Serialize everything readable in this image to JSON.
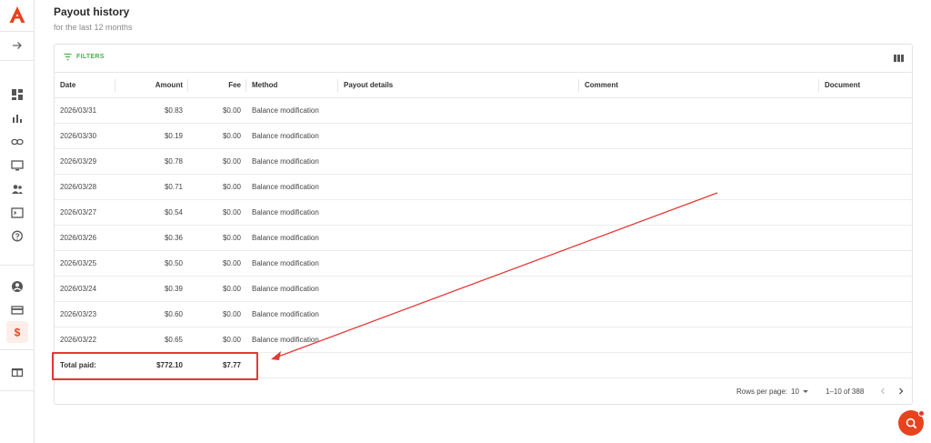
{
  "colors": {
    "brand": "#e8431f",
    "filters_green": "#4caf50",
    "annotation_red": "#e53935"
  },
  "sidebar": {
    "logo": "brand-logo-icon",
    "items": [
      {
        "icon": "arrow-right-icon",
        "name": "expand-sidebar"
      },
      {
        "icon": "dashboard-icon",
        "name": "dashboard"
      },
      {
        "icon": "bar-chart-icon",
        "name": "statistics"
      },
      {
        "icon": "link-icon",
        "name": "links"
      },
      {
        "icon": "monitor-icon",
        "name": "websites"
      },
      {
        "icon": "users-icon",
        "name": "referrals"
      },
      {
        "icon": "terminal-icon",
        "name": "api"
      },
      {
        "icon": "help-icon",
        "name": "help"
      },
      {
        "icon": "account-icon",
        "name": "account"
      },
      {
        "icon": "card-icon",
        "name": "payment-methods"
      },
      {
        "icon": "dollar-icon",
        "name": "payouts",
        "active": true
      },
      {
        "icon": "gift-icon",
        "name": "rewards"
      }
    ]
  },
  "header": {
    "title": "Payout history",
    "subtitle": "for the last 12 months"
  },
  "toolbar": {
    "filters_label": "FILTERS",
    "columns_icon": "columns-icon"
  },
  "table": {
    "columns": [
      "Date",
      "Amount",
      "Fee",
      "Method",
      "Payout details",
      "Comment",
      "Document"
    ],
    "rows": [
      {
        "date": "2026/03/31",
        "amount": "$0.83",
        "fee": "$0.00",
        "method": "Balance modification"
      },
      {
        "date": "2026/03/30",
        "amount": "$0.19",
        "fee": "$0.00",
        "method": "Balance modification"
      },
      {
        "date": "2026/03/29",
        "amount": "$0.78",
        "fee": "$0.00",
        "method": "Balance modification"
      },
      {
        "date": "2026/03/28",
        "amount": "$0.71",
        "fee": "$0.00",
        "method": "Balance modification"
      },
      {
        "date": "2026/03/27",
        "amount": "$0.54",
        "fee": "$0.00",
        "method": "Balance modification"
      },
      {
        "date": "2026/03/26",
        "amount": "$0.36",
        "fee": "$0.00",
        "method": "Balance modification"
      },
      {
        "date": "2026/03/25",
        "amount": "$0.50",
        "fee": "$0.00",
        "method": "Balance modification"
      },
      {
        "date": "2026/03/24",
        "amount": "$0.39",
        "fee": "$0.00",
        "method": "Balance modification"
      },
      {
        "date": "2026/03/23",
        "amount": "$0.60",
        "fee": "$0.00",
        "method": "Balance modification"
      },
      {
        "date": "2026/03/22",
        "amount": "$0.65",
        "fee": "$0.00",
        "method": "Balance modification"
      }
    ],
    "total": {
      "label": "Total paid:",
      "amount": "$772.10",
      "fee": "$7.77"
    }
  },
  "pagination": {
    "rows_per_page_label": "Rows per page:",
    "rows_per_page_value": "10",
    "range": "1–10 of 388"
  },
  "chat": {
    "icon": "chat-search-icon"
  }
}
